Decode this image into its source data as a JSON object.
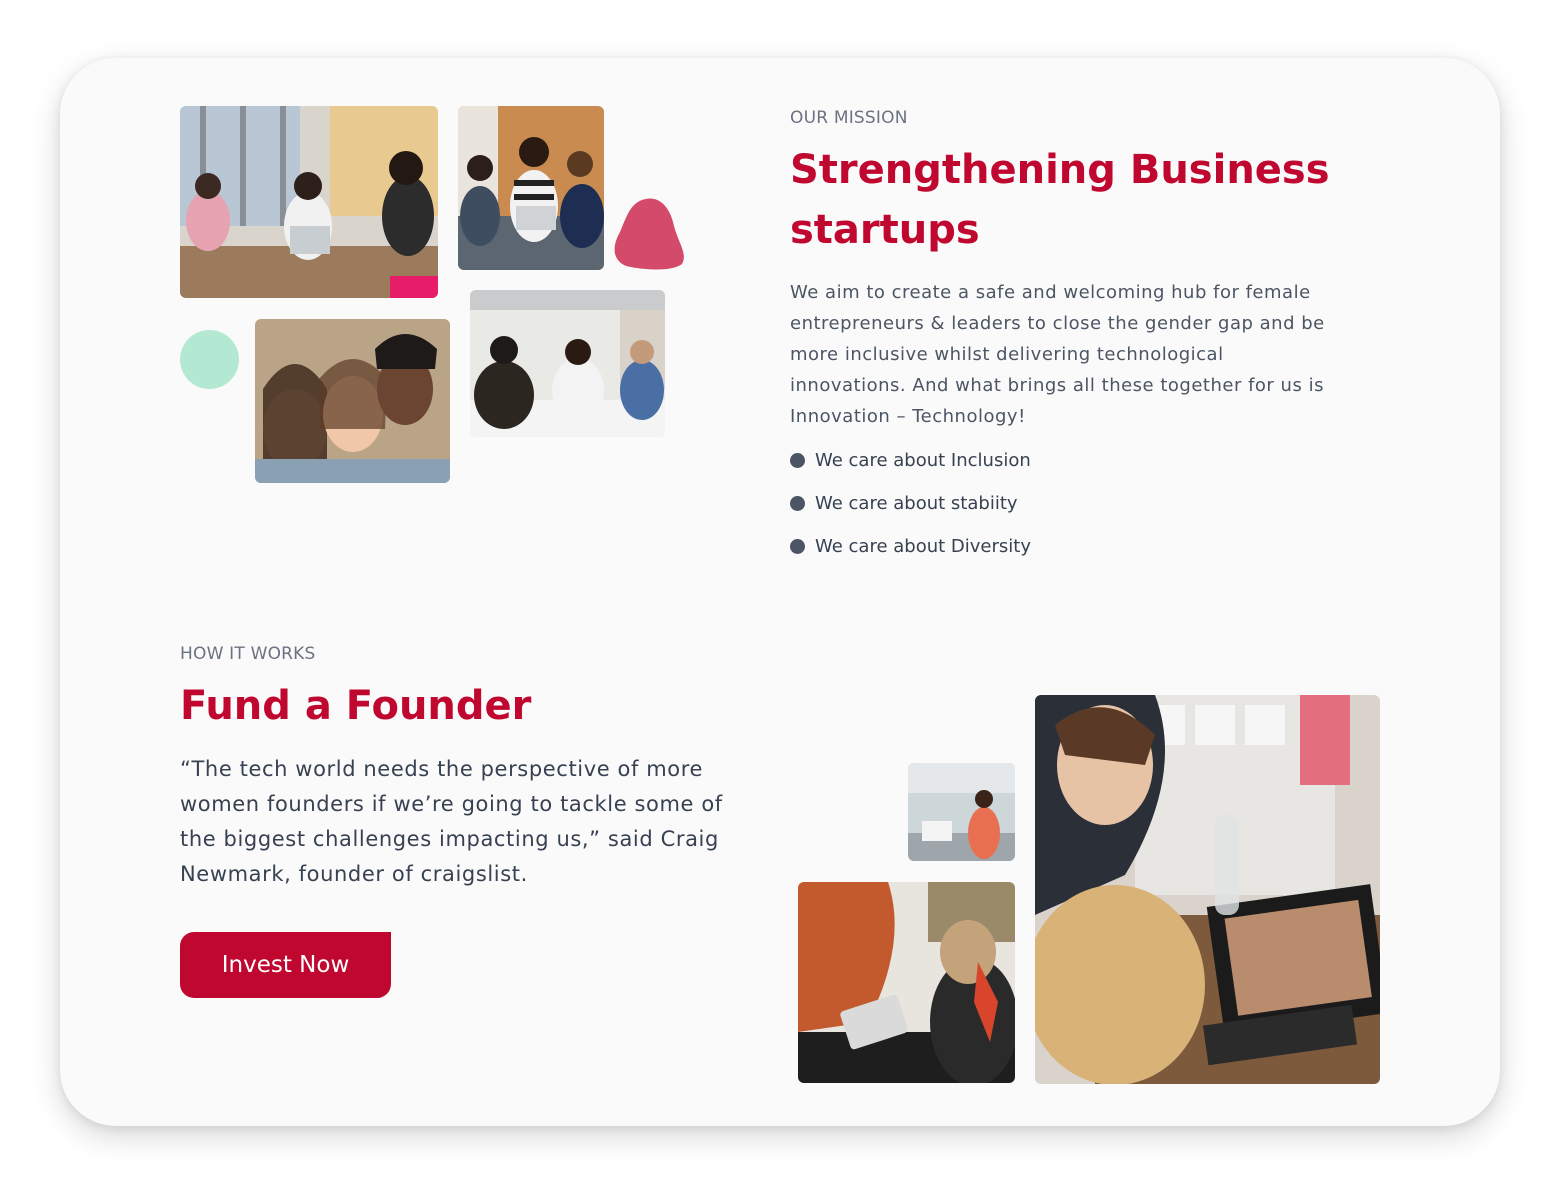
{
  "mission": {
    "eyebrow": "OUR MISSION",
    "title": "Strengthening Business startups",
    "description": "We aim to create a safe and welcoming hub for female entrepreneurs & leaders to close the gender gap and be more inclusive whilst delivering technological innovations. And what brings all these together for us is Innovation – Technology!",
    "values": [
      "We care about Inclusion",
      "We care about stabiity",
      "We care about Diversity"
    ]
  },
  "how_it_works": {
    "eyebrow": "HOW IT WORKS",
    "title": "Fund a Founder",
    "quote": "“The tech world needs the perspective of more women founders if we’re going to tackle some of the biggest challenges impacting us,” said Craig Newmark, founder of craigslist.",
    "button_label": "Invest Now"
  },
  "colors": {
    "accent": "#c0072f",
    "blob_pink": "#d44a6a",
    "mint_circle": "#b3e8d2",
    "bullet": "#4b5563"
  }
}
